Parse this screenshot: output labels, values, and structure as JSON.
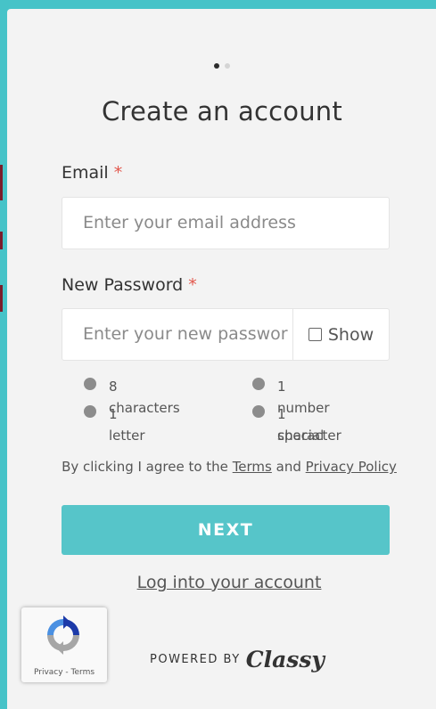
{
  "progress": {
    "current_step": 1,
    "total_steps": 2
  },
  "title": "Create an account",
  "email": {
    "label": "Email",
    "required_marker": "*",
    "placeholder": "Enter your email address"
  },
  "password": {
    "label": "New Password",
    "required_marker": "*",
    "placeholder": "Enter your new passwor",
    "show_label": "Show"
  },
  "requirements": [
    "8 characters",
    "1 number",
    "1 letter",
    "1 special",
    "character"
  ],
  "agreement": {
    "prefix": "By clicking I agree to the",
    "terms": "Terms",
    "and": "and",
    "privacy": "Privacy Policy"
  },
  "next_label": "NEXT",
  "login_link": "Log into your account",
  "recaptcha": {
    "text": "Privacy - Terms"
  },
  "powered_by": {
    "text": "POWERED BY",
    "brand": "Classy"
  },
  "colors": {
    "background": "#46c3c8",
    "accent": "#56c5c9",
    "required": "#e2574c",
    "modal": "#f3f3f3"
  }
}
